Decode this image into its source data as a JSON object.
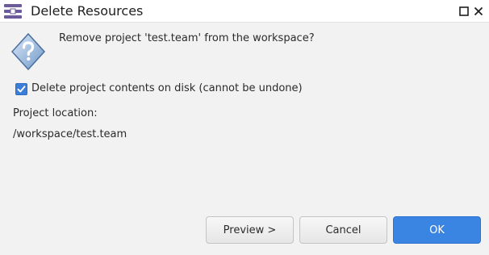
{
  "window": {
    "title": "Delete Resources"
  },
  "icons": {
    "app": "eclipse-app-icon",
    "question": "question-icon",
    "maximize": "maximize-icon",
    "close": "close-icon",
    "check": "checkmark-icon"
  },
  "dialog": {
    "message": "Remove project 'test.team' from the workspace?",
    "delete_contents": {
      "label": "Delete project contents on disk (cannot be undone)",
      "checked": true
    },
    "location_label": "Project location:",
    "location_value": "/workspace/test.team"
  },
  "buttons": {
    "preview": "Preview >",
    "cancel": "Cancel",
    "ok": "OK"
  },
  "colors": {
    "accent": "#3a84e2",
    "checkbox": "#3b7dd8"
  }
}
